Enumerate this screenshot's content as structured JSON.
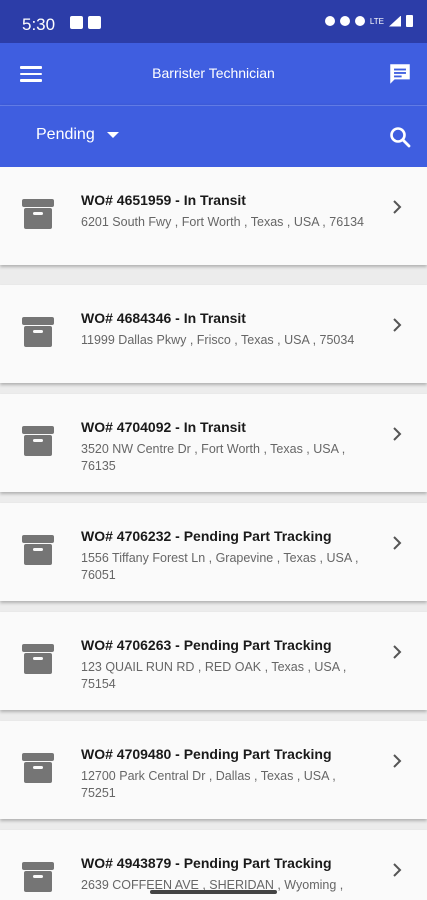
{
  "status_bar": {
    "time": "5:30",
    "network": "LTE"
  },
  "app_bar": {
    "title": "Barrister Technician"
  },
  "filter": {
    "selected": "Pending"
  },
  "work_orders": [
    {
      "title": "WO# 4651959 - In Transit",
      "address": "6201 South Fwy , Fort Worth , Texas , USA , 76134"
    },
    {
      "title": "WO# 4684346 - In Transit",
      "address": "11999 Dallas Pkwy , Frisco , Texas , USA , 75034"
    },
    {
      "title": "WO# 4704092 - In Transit",
      "address": "3520 NW Centre Dr , Fort Worth , Texas , USA , 76135"
    },
    {
      "title": "WO# 4706232 - Pending Part Tracking",
      "address": "1556 Tiffany Forest Ln , Grapevine , Texas , USA , 76051"
    },
    {
      "title": "WO# 4706263 - Pending Part Tracking",
      "address": "123 QUAIL RUN RD , RED OAK , Texas , USA , 75154"
    },
    {
      "title": "WO# 4709480 - Pending Part Tracking",
      "address": "12700 Park Central Dr , Dallas , Texas , USA , 75251"
    },
    {
      "title": "WO# 4943879 - Pending Part Tracking",
      "address": "2639 COFFEEN AVE , SHERIDAN , Wyoming ,"
    }
  ],
  "colors": {
    "primary": "#3f5ee0",
    "status_bar": "#2c3da8",
    "icon_gray": "#757575"
  },
  "icons": {
    "menu": "menu-icon",
    "chat": "chat-icon",
    "search": "search-icon",
    "row": "archive-box-icon",
    "chevron": "chevron-right-icon"
  }
}
